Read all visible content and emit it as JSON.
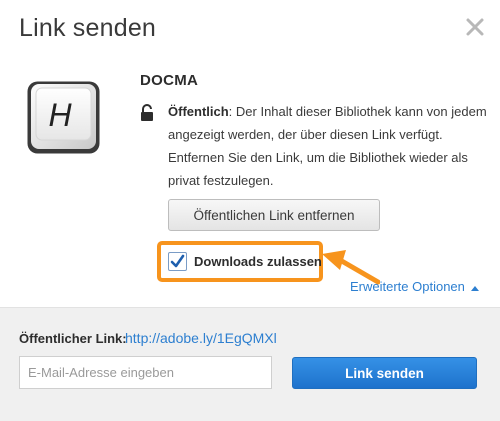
{
  "dialog": {
    "title": "Link senden",
    "close_icon": "close-icon"
  },
  "library": {
    "icon_letter": "H",
    "name": "DOCMA",
    "lock_icon": "unlock-icon",
    "visibility_label": "Öffentlich",
    "description": ": Der Inhalt dieser Bibliothek kann von jedem angezeigt werden, der über diesen Link verfügt. Entfernen Sie den Link, um die Bibliothek wieder als privat festzulegen."
  },
  "actions": {
    "remove_link_label": "Öffentlichen Link entfernen",
    "allow_downloads_label": "Downloads zulassen",
    "allow_downloads_checked": true,
    "advanced_options_label": "Erweiterte Optionen"
  },
  "footer": {
    "public_link_label": "Öffentlicher Link:",
    "public_link_url": "http://adobe.ly/1EgQMXl",
    "email_placeholder": "E-Mail-Adresse eingeben",
    "send_label": "Link senden"
  },
  "colors": {
    "accent": "#2d7fd0",
    "highlight": "#f7941d",
    "primary_button": "#1e72cc"
  }
}
